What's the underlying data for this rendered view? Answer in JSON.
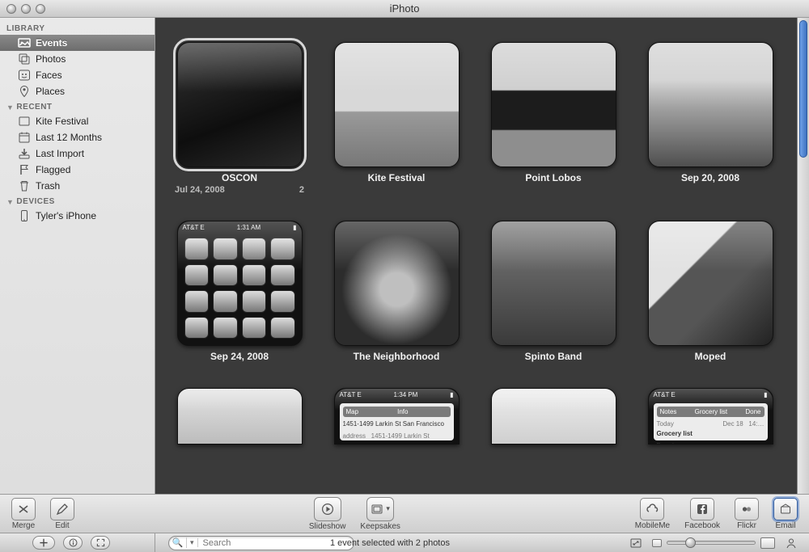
{
  "window": {
    "title": "iPhoto"
  },
  "sidebar": {
    "sections": [
      {
        "label": "LIBRARY",
        "collapsible": false,
        "items": [
          {
            "label": "Events",
            "icon": "events-icon",
            "selected": true
          },
          {
            "label": "Photos",
            "icon": "photos-icon",
            "selected": false
          },
          {
            "label": "Faces",
            "icon": "faces-icon",
            "selected": false
          },
          {
            "label": "Places",
            "icon": "places-icon",
            "selected": false
          }
        ]
      },
      {
        "label": "RECENT",
        "collapsible": true,
        "items": [
          {
            "label": "Kite Festival",
            "icon": "event-icon",
            "selected": false
          },
          {
            "label": "Last 12 Months",
            "icon": "calendar-icon",
            "selected": false
          },
          {
            "label": "Last Import",
            "icon": "import-icon",
            "selected": false
          },
          {
            "label": "Flagged",
            "icon": "flag-icon",
            "selected": false
          },
          {
            "label": "Trash",
            "icon": "trash-icon",
            "selected": false
          }
        ]
      },
      {
        "label": "DEVICES",
        "collapsible": true,
        "items": [
          {
            "label": "Tyler's iPhone",
            "icon": "iphone-icon",
            "selected": false
          }
        ]
      }
    ]
  },
  "events": [
    {
      "title": "OSCON",
      "date": "Jul 24, 2008",
      "count": "2",
      "selected": true
    },
    {
      "title": "Kite Festival",
      "selected": false
    },
    {
      "title": "Point Lobos",
      "selected": false
    },
    {
      "title": "Sep 20, 2008",
      "selected": false
    },
    {
      "title": "Sep 24, 2008",
      "selected": false
    },
    {
      "title": "The Neighborhood",
      "selected": false
    },
    {
      "title": "Spinto Band",
      "selected": false
    },
    {
      "title": "Moped",
      "selected": false
    }
  ],
  "partial_events": [
    {
      "title": ""
    },
    {
      "title": ""
    },
    {
      "title": ""
    },
    {
      "title": ""
    }
  ],
  "toolbar": {
    "merge": "Merge",
    "edit": "Edit",
    "slideshow": "Slideshow",
    "keepsakes": "Keepsakes",
    "mobileme": "MobileMe",
    "facebook": "Facebook",
    "flickr": "Flickr",
    "email": "Email"
  },
  "statusbar": {
    "search_placeholder": "Search",
    "status_text": "1 event selected with 2 photos"
  }
}
